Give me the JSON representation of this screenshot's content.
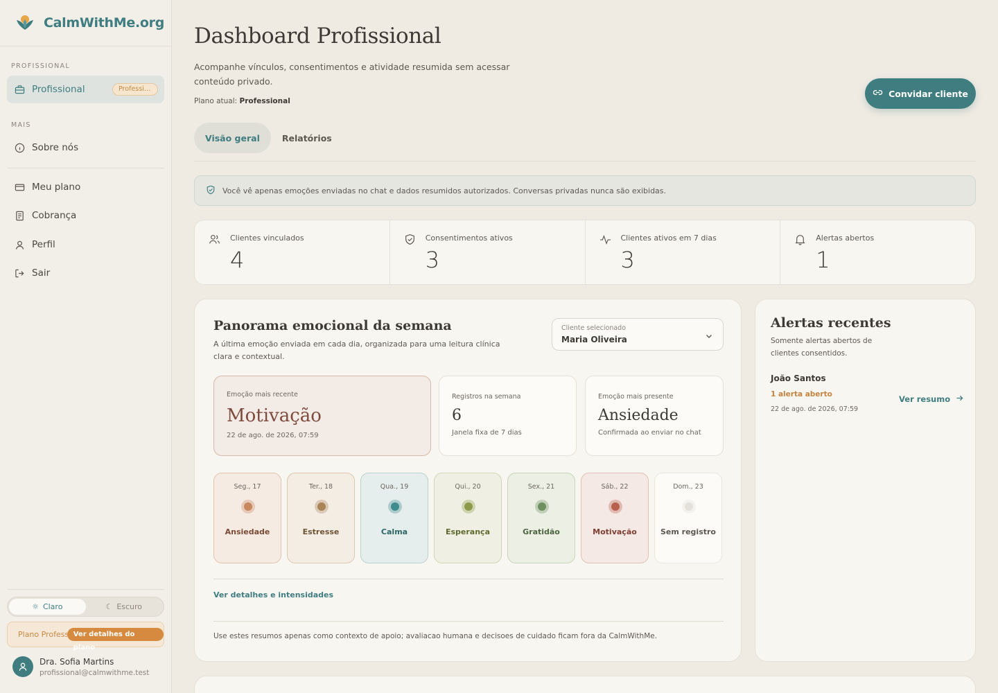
{
  "brand": {
    "name": "CalmWithMe.org"
  },
  "sidebar": {
    "section_professional": "PROFISSIONAL",
    "professional_item": {
      "label": "Profissional",
      "badge": "Professional"
    },
    "section_more": "MAIS",
    "about": "Sobre nós",
    "items": [
      {
        "label": "Meu plano",
        "icon": "card-icon"
      },
      {
        "label": "Cobrança",
        "icon": "receipt-icon"
      },
      {
        "label": "Perfil",
        "icon": "user-icon"
      },
      {
        "label": "Sair",
        "icon": "logout-icon"
      }
    ],
    "theme": {
      "light": "Claro",
      "dark": "Escuro"
    },
    "plan": {
      "label": "Plano Professional",
      "button": "Ver detalhes do plano"
    },
    "user": {
      "name": "Dra. Sofia Martins",
      "email": "profissional@calmwithme.test"
    }
  },
  "header": {
    "title": "Dashboard Profissional",
    "subtitle": "Acompanhe vínculos, consentimentos e atividade resumida sem acessar conteúdo privado.",
    "plan_prefix": "Plano atual:",
    "plan_value": "Professional",
    "invite_button": "Convidar cliente"
  },
  "tabs": [
    "Visão geral",
    "Relatórios"
  ],
  "notice": "Você vê apenas emoções enviadas no chat e dados resumidos autorizados. Conversas privadas nunca são exibidas.",
  "stats": [
    {
      "label": "Clientes vinculados",
      "value": "4",
      "icon": "users-icon"
    },
    {
      "label": "Consentimentos ativos",
      "value": "3",
      "icon": "shield-icon"
    },
    {
      "label": "Clientes ativos em 7 dias",
      "value": "3",
      "icon": "activity-icon"
    },
    {
      "label": "Alertas abertos",
      "value": "1",
      "icon": "bell-icon"
    }
  ],
  "panorama": {
    "title": "Panorama emocional da semana",
    "subtitle": "A última emoção enviada em cada dia, organizada para uma leitura clínica clara e contextual.",
    "select": {
      "label": "Cliente selecionado",
      "value": "Maria Oliveira"
    },
    "recent": {
      "label": "Emoção mais recente",
      "value": "Motivação",
      "date": "22 de ago. de 2026, 07:59"
    },
    "records": {
      "label": "Registros na semana",
      "value": "6",
      "foot": "Janela fixa de 7 dias"
    },
    "present": {
      "label": "Emoção mais presente",
      "value": "Ansiedade",
      "foot": "Confirmada ao enviar no chat"
    },
    "days": [
      {
        "date": "Seg., 17",
        "emotion": "Ansiedade",
        "color": "#c98760",
        "bg": "#f5ebe3",
        "border": "#e3c3ae",
        "text": "#7a4a36"
      },
      {
        "date": "Ter., 18",
        "emotion": "Estresse",
        "color": "#a98458",
        "bg": "#f4ede4",
        "border": "#dcc8ad",
        "text": "#6e5435"
      },
      {
        "date": "Qua., 19",
        "emotion": "Calma",
        "color": "#3f8b8e",
        "bg": "#e5eeec",
        "border": "#b9d2d0",
        "text": "#2f6668"
      },
      {
        "date": "Qui., 20",
        "emotion": "Esperança",
        "color": "#8e9c4a",
        "bg": "#eff0e3",
        "border": "#d2d6b4",
        "text": "#5f6a2f"
      },
      {
        "date": "Sex., 21",
        "emotion": "Gratidão",
        "color": "#6e9060",
        "bg": "#ebefe4",
        "border": "#c8d4bd",
        "text": "#4d6640"
      },
      {
        "date": "Sáb., 22",
        "emotion": "Motivação",
        "color": "#b9614f",
        "bg": "#f5e9e5",
        "border": "#e3c0b7",
        "text": "#7e3f33"
      },
      {
        "date": "Dom., 23",
        "emotion": "Sem registro",
        "color": "#e4e1db",
        "bg": "#fcfbf8",
        "border": "#ebe7df",
        "text": "#5c5850"
      }
    ],
    "details_link": "Ver detalhes e intensidades",
    "footer": "Use estes resumos apenas como contexto de apoio; avaliacao humana e decisoes de cuidado ficam fora da CalmWithMe."
  },
  "alerts": {
    "title": "Alertas recentes",
    "subtitle": "Somente alertas abertos de clientes consentidos.",
    "item": {
      "name": "João Santos",
      "count": "1 alerta aberto",
      "date": "22 de ago. de 2026, 07:59",
      "link": "Ver resumo"
    }
  },
  "colors": {
    "accent": "#3f7d80",
    "warm": "#d68a3f",
    "background": "#efebe3"
  }
}
